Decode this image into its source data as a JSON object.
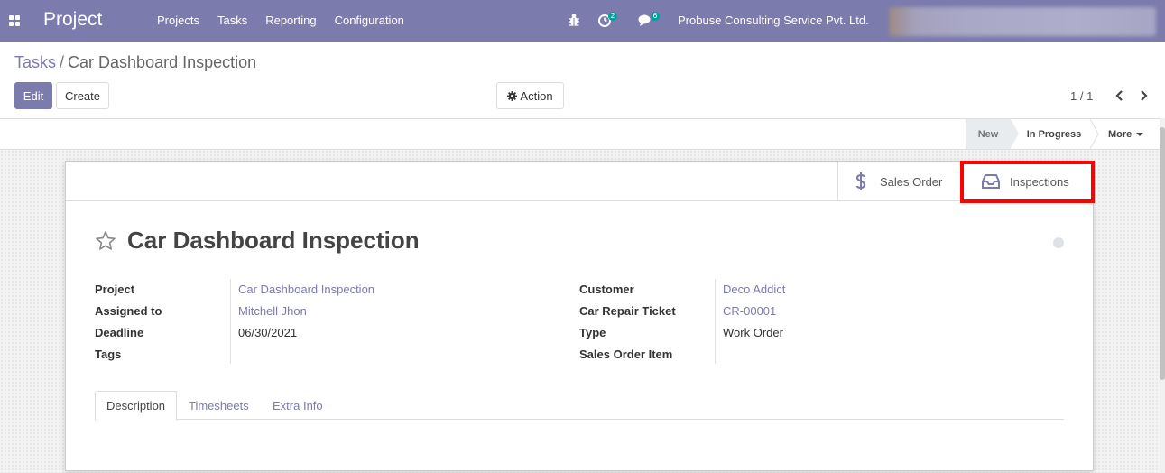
{
  "navbar": {
    "app_name": "Project",
    "menu": [
      "Projects",
      "Tasks",
      "Reporting",
      "Configuration"
    ],
    "activity_count": "2",
    "message_count": "6",
    "company": "Probuse Consulting Service Pvt. Ltd."
  },
  "breadcrumb": {
    "parent": "Tasks",
    "separator": "/",
    "current": "Car Dashboard Inspection"
  },
  "toolbar": {
    "edit_label": "Edit",
    "create_label": "Create",
    "action_label": "Action"
  },
  "pager": {
    "value": "1 / 1"
  },
  "statusbar": {
    "stages": [
      "New",
      "In Progress"
    ],
    "more_label": "More",
    "active_stage": "New"
  },
  "smart_buttons": {
    "sales_order": "Sales Order",
    "inspections": "Inspections"
  },
  "record": {
    "title": "Car Dashboard Inspection"
  },
  "fields_left": [
    {
      "label": "Project",
      "value": "Car Dashboard Inspection"
    },
    {
      "label": "Assigned to",
      "value": "Mitchell Jhon"
    },
    {
      "label": "Deadline",
      "value": "06/30/2021"
    },
    {
      "label": "Tags",
      "value": ""
    }
  ],
  "fields_right": [
    {
      "label": "Customer",
      "value": "Deco Addict"
    },
    {
      "label": "Car Repair Ticket",
      "value": "CR-00001"
    },
    {
      "label": "Type",
      "value": "Work Order"
    },
    {
      "label": "Sales Order Item",
      "value": ""
    }
  ],
  "tabs": [
    "Description",
    "Timesheets",
    "Extra Info"
  ],
  "colors": {
    "brand": "#7c7bad",
    "badge": "#00a09d",
    "highlight": "#ff0000"
  }
}
